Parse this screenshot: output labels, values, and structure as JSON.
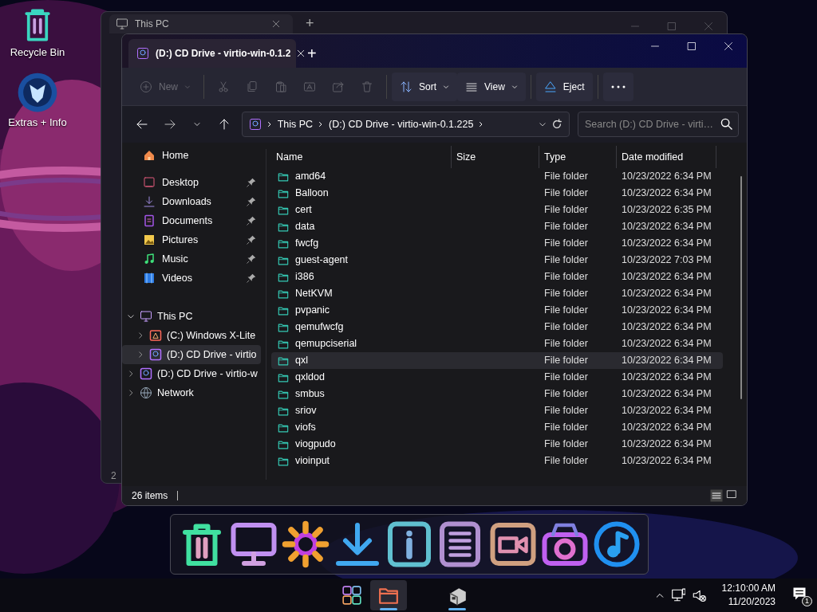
{
  "desktop_icons": [
    {
      "kind": "recycle",
      "label": "Recycle Bin"
    },
    {
      "kind": "orb",
      "label": "Extras + Info"
    }
  ],
  "back_window": {
    "tab": "This PC",
    "new_tab": "+",
    "status": "2"
  },
  "window": {
    "tab": "(D:) CD Drive - virtio-win-0.1.2",
    "new_tab": "+",
    "toolbar": [
      {
        "kind": "new",
        "label": "New",
        "disabled": true
      },
      {
        "kind": "cut",
        "disabled": true
      },
      {
        "kind": "copy",
        "disabled": true
      },
      {
        "kind": "paste",
        "disabled": true
      },
      {
        "kind": "rename",
        "disabled": true
      },
      {
        "kind": "share",
        "disabled": true
      },
      {
        "kind": "delete",
        "disabled": true
      },
      {
        "kind": "sort",
        "label": "Sort",
        "disabled": false
      },
      {
        "kind": "view",
        "label": "View",
        "disabled": false
      },
      {
        "kind": "eject",
        "label": "Eject",
        "disabled": false
      },
      {
        "kind": "more",
        "disabled": false
      }
    ],
    "address": {
      "crumbs": [
        "This PC",
        "(D:) CD Drive - virtio-win-0.1.225"
      ]
    },
    "search": {
      "placeholder": "Search (D:) CD Drive - virti…"
    },
    "nav": [
      {
        "kind": "home",
        "label": "Home",
        "pinned": false
      },
      {
        "kind": "desktop",
        "label": "Desktop",
        "pinned": true
      },
      {
        "kind": "downloads",
        "label": "Downloads",
        "pinned": true
      },
      {
        "kind": "documents",
        "label": "Documents",
        "pinned": true
      },
      {
        "kind": "pictures",
        "label": "Pictures",
        "pinned": true
      },
      {
        "kind": "music",
        "label": "Music",
        "pinned": true
      },
      {
        "kind": "videos",
        "label": "Videos",
        "pinned": true
      }
    ],
    "tree": [
      {
        "kind": "pc",
        "label": "This PC",
        "expanded": true,
        "selected": false,
        "children": [
          {
            "kind": "cdrive",
            "label": "(C:) Windows X-Lite",
            "expanded": false,
            "selected": false
          },
          {
            "kind": "dvd",
            "label": "(D:) CD Drive - virtio",
            "expanded": false,
            "selected": true
          }
        ]
      },
      {
        "kind": "dvd",
        "label": "(D:) CD Drive - virtio-w",
        "expanded": false,
        "selected": false
      },
      {
        "kind": "network",
        "label": "Network",
        "expanded": false,
        "selected": false
      }
    ],
    "columns": [
      "Name",
      "Size",
      "Type",
      "Date modified"
    ],
    "rows": [
      {
        "name": "amd64",
        "type": "File folder",
        "date": "10/23/2022 6:34 PM",
        "selected": false
      },
      {
        "name": "Balloon",
        "type": "File folder",
        "date": "10/23/2022 6:34 PM",
        "selected": false
      },
      {
        "name": "cert",
        "type": "File folder",
        "date": "10/23/2022 6:35 PM",
        "selected": false
      },
      {
        "name": "data",
        "type": "File folder",
        "date": "10/23/2022 6:34 PM",
        "selected": false
      },
      {
        "name": "fwcfg",
        "type": "File folder",
        "date": "10/23/2022 6:34 PM",
        "selected": false
      },
      {
        "name": "guest-agent",
        "type": "File folder",
        "date": "10/23/2022 7:03 PM",
        "selected": false
      },
      {
        "name": "i386",
        "type": "File folder",
        "date": "10/23/2022 6:34 PM",
        "selected": false
      },
      {
        "name": "NetKVM",
        "type": "File folder",
        "date": "10/23/2022 6:34 PM",
        "selected": false
      },
      {
        "name": "pvpanic",
        "type": "File folder",
        "date": "10/23/2022 6:34 PM",
        "selected": false
      },
      {
        "name": "qemufwcfg",
        "type": "File folder",
        "date": "10/23/2022 6:34 PM",
        "selected": false
      },
      {
        "name": "qemupciserial",
        "type": "File folder",
        "date": "10/23/2022 6:34 PM",
        "selected": false
      },
      {
        "name": "qxl",
        "type": "File folder",
        "date": "10/23/2022 6:34 PM",
        "selected": true
      },
      {
        "name": "qxldod",
        "type": "File folder",
        "date": "10/23/2022 6:34 PM",
        "selected": false
      },
      {
        "name": "smbus",
        "type": "File folder",
        "date": "10/23/2022 6:34 PM",
        "selected": false
      },
      {
        "name": "sriov",
        "type": "File folder",
        "date": "10/23/2022 6:34 PM",
        "selected": false
      },
      {
        "name": "viofs",
        "type": "File folder",
        "date": "10/23/2022 6:34 PM",
        "selected": false
      },
      {
        "name": "viogpudo",
        "type": "File folder",
        "date": "10/23/2022 6:34 PM",
        "selected": false
      },
      {
        "name": "vioinput",
        "type": "File folder",
        "date": "10/23/2022 6:34 PM",
        "selected": false
      }
    ],
    "status": "26 items"
  },
  "dock": [
    {
      "kind": "trash"
    },
    {
      "kind": "monitor"
    },
    {
      "kind": "gear"
    },
    {
      "kind": "download"
    },
    {
      "kind": "info"
    },
    {
      "kind": "list"
    },
    {
      "kind": "video"
    },
    {
      "kind": "camera"
    },
    {
      "kind": "music"
    }
  ],
  "taskbar": [
    {
      "kind": "start",
      "selected": false,
      "running": false
    },
    {
      "kind": "explorer",
      "selected": true,
      "running": true
    },
    {
      "kind": "app",
      "selected": false,
      "running": true
    }
  ],
  "tray": {
    "time": "12:10:00 AM",
    "date": "11/20/2023",
    "notifications": "1"
  }
}
